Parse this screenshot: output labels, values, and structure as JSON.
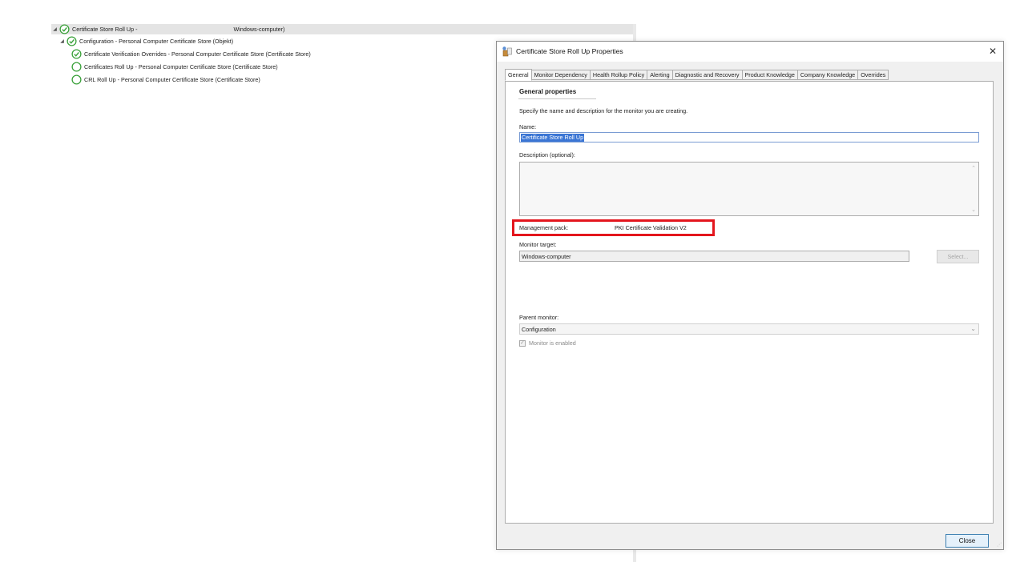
{
  "tree": {
    "items": [
      {
        "label": "Certificate Store Roll Up -",
        "target": "Windows-computer)",
        "expander": "◢",
        "status": "healthy"
      },
      {
        "label": "Configuration - Personal Computer Certificate Store (Objekt)",
        "expander": "◢",
        "status": "healthy"
      },
      {
        "label": "Certificate Verification Overrides - Personal Computer Certificate Store (Certificate Store)",
        "status": "healthy"
      },
      {
        "label": "Certificates Roll Up - Personal Computer Certificate Store (Certificate Store)",
        "status": "not-monitored"
      },
      {
        "label": "CRL Roll Up - Personal Computer Certificate Store (Certificate Store)",
        "status": "not-monitored"
      }
    ]
  },
  "dialog": {
    "title": "Certificate Store Roll Up Properties",
    "close_glyph": "✕",
    "tabs": [
      {
        "label": "General",
        "active": true
      },
      {
        "label": "Monitor Dependency"
      },
      {
        "label": "Health Rollup Policy"
      },
      {
        "label": "Alerting"
      },
      {
        "label": "Diagnostic and Recovery"
      },
      {
        "label": "Product Knowledge"
      },
      {
        "label": "Company Knowledge"
      },
      {
        "label": "Overrides"
      }
    ],
    "general": {
      "section_title": "General properties",
      "intro": "Specify the name and description for the monitor you are creating.",
      "name_label": "Name:",
      "name_value": "Certificate Store Roll Up",
      "description_label": "Description (optional):",
      "description_value": "",
      "management_pack_label": "Management pack:",
      "management_pack_value": "PKI Certificate Validation V2",
      "monitor_target_label": "Monitor target:",
      "monitor_target_value": "Windows-computer",
      "select_button": "Select...",
      "parent_monitor_label": "Parent monitor:",
      "parent_monitor_value": "Configuration",
      "monitor_enabled_label": "Monitor is enabled",
      "monitor_enabled_checked": true
    },
    "close_button": "Close"
  },
  "colors": {
    "highlight_box": "#e3161d",
    "selection": "#3a75d4",
    "healthy_icon": "#3aa13a"
  }
}
